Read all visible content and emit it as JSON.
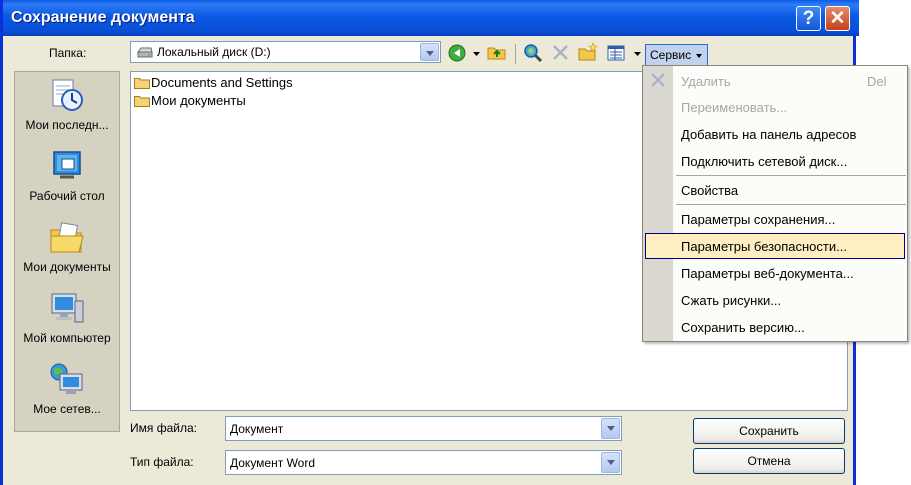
{
  "window": {
    "title": "Сохранение документа",
    "help_glyph": "?",
    "close_glyph": "✕"
  },
  "lookin": {
    "label": "Папка:",
    "value": "Локальный диск (D:)"
  },
  "toolbar": {
    "servis_label": "Сервис"
  },
  "places": [
    {
      "label": "Мои последн...",
      "icon": "recent-documents-icon"
    },
    {
      "label": "Рабочий стол",
      "icon": "desktop-icon"
    },
    {
      "label": "Мои документы",
      "icon": "my-documents-icon"
    },
    {
      "label": "Мой компьютер",
      "icon": "my-computer-icon"
    },
    {
      "label": "Мое сетев...",
      "icon": "network-places-icon"
    }
  ],
  "files": [
    {
      "name": "Documents and Settings",
      "icon": "folder-icon"
    },
    {
      "name": "Мои документы",
      "icon": "folder-icon"
    }
  ],
  "filename": {
    "label": "Имя файла:",
    "value": "Документ"
  },
  "filetype": {
    "label": "Тип файла:",
    "value": "Документ Word"
  },
  "buttons": {
    "save": "Сохранить",
    "cancel": "Отмена"
  },
  "menu": {
    "delete": {
      "label": "Удалить",
      "key": "Del"
    },
    "rename": "Переименовать...",
    "add_to_places": "Добавить на панель адресов",
    "map_drive": "Подключить сетевой диск...",
    "properties": "Свойства",
    "save_options": "Параметры сохранения...",
    "security_options": "Параметры безопасности...",
    "web_options": "Параметры веб-документа...",
    "compress": "Сжать рисунки...",
    "save_version": "Сохранить версию..."
  }
}
